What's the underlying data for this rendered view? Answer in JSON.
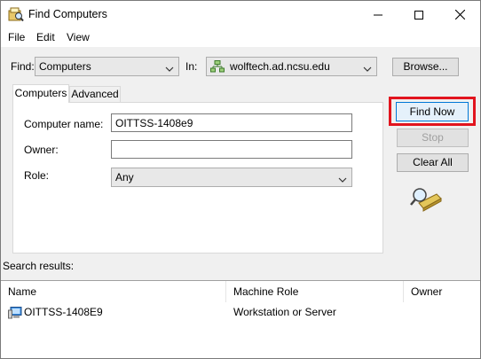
{
  "window": {
    "title": "Find Computers",
    "menu": [
      "File",
      "Edit",
      "View"
    ]
  },
  "search_bar": {
    "find_label": "Find:",
    "find_value": "Computers",
    "in_label": "In:",
    "in_value": "wolftech.ad.ncsu.edu",
    "browse_label": "Browse..."
  },
  "tabs": [
    {
      "label": "Computers",
      "active": true
    },
    {
      "label": "Advanced",
      "active": false
    }
  ],
  "form": {
    "computer_name_label": "Computer name:",
    "computer_name_value": "OITTSS-1408e9",
    "owner_label": "Owner:",
    "owner_value": "",
    "role_label": "Role:",
    "role_value": "Any"
  },
  "actions": {
    "find_now": "Find Now",
    "stop": "Stop",
    "clear_all": "Clear All"
  },
  "results": {
    "label": "Search results:",
    "columns": [
      "Name",
      "Machine Role",
      "Owner"
    ],
    "rows": [
      {
        "name": "OITTSS-1408E9",
        "role": "Workstation or Server",
        "owner": ""
      }
    ]
  },
  "colors": {
    "highlight": "#e2141e",
    "default_button_border": "#0078d7"
  },
  "icons": {
    "app": "find-computers-icon",
    "domain": "domain-icon",
    "computer": "computer-icon",
    "search": "magnifier-search-icon"
  }
}
